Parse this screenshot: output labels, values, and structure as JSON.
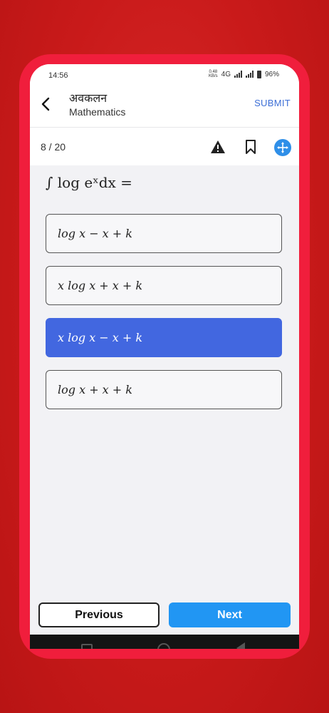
{
  "status": {
    "time": "14:56",
    "net_speed_top": "0.48",
    "net_speed_bottom": "KB/s",
    "network": "4G",
    "battery": "96%"
  },
  "header": {
    "title": "अवकलन",
    "subtitle": "Mathematics",
    "submit_label": "SUBMIT"
  },
  "question_bar": {
    "counter": "8 / 20"
  },
  "question": {
    "text": "∫ log eˣdx ="
  },
  "options": [
    {
      "text": "log x − x + k",
      "selected": false
    },
    {
      "text": "x log x + x + k",
      "selected": false
    },
    {
      "text": "x log x − x + k",
      "selected": true
    },
    {
      "text": "log x + x + k",
      "selected": false
    }
  ],
  "footer": {
    "previous_label": "Previous",
    "next_label": "Next"
  },
  "colors": {
    "accent_blue": "#4267e0",
    "next_button": "#2196f3",
    "frame_red": "#f01e3c",
    "submit_text": "#3d6fd6"
  },
  "icons": [
    "back-arrow-icon",
    "warning-icon",
    "bookmark-icon",
    "move-icon",
    "square-nav-icon",
    "home-nav-icon",
    "back-nav-icon"
  ]
}
